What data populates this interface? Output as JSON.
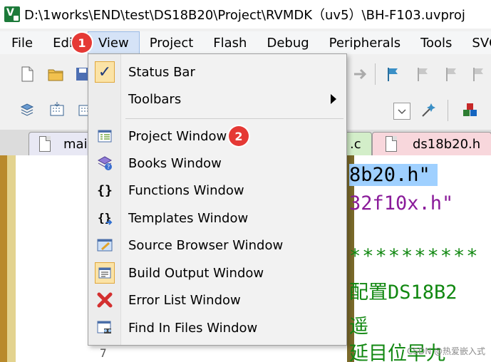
{
  "window": {
    "title": "D:\\1works\\END\\test\\DS18B20\\Project\\RVMDK（uv5）\\BH-F103.uvproj"
  },
  "menubar": {
    "items": [
      "File",
      "Edit",
      "View",
      "Project",
      "Flash",
      "Debug",
      "Peripherals",
      "Tools",
      "SVC"
    ],
    "active": "View"
  },
  "tabs": [
    {
      "label": "mai",
      "color": "#e8e8f4"
    },
    {
      "label": ".c",
      "color": "#d3eec9"
    },
    {
      "label": "ds18b20.h",
      "color": "#f8d7dc"
    }
  ],
  "editor": {
    "lines": [
      "8b20.h\"",
      "32f10x.h\"",
      "**********",
      "配置DS18B2",
      "遥",
      "延目位早九"
    ],
    "line_number": "7"
  },
  "view_menu": {
    "items": [
      {
        "label": "Status Bar",
        "icon": "checkmark-icon",
        "checked": true
      },
      {
        "label": "Toolbars",
        "icon": "",
        "submenu": true
      },
      {
        "label": "Project Window",
        "icon": "project-window-icon"
      },
      {
        "label": "Books Window",
        "icon": "books-icon"
      },
      {
        "label": "Functions Window",
        "icon": "functions-icon"
      },
      {
        "label": "Templates Window",
        "icon": "templates-icon"
      },
      {
        "label": "Source Browser Window",
        "icon": "source-browser-icon"
      },
      {
        "label": "Build Output Window",
        "icon": "build-output-icon",
        "checked": true
      },
      {
        "label": "Error List Window",
        "icon": "error-list-icon"
      },
      {
        "label": "Find In Files Window",
        "icon": "find-in-files-icon"
      }
    ]
  },
  "annotations": {
    "step1": "1",
    "step2": "2"
  },
  "watermark": "CSDN @热爱嵌入式",
  "colors": {
    "badge": "#e53935",
    "highlight": "#d5e3f7",
    "checked_bg": "#fbe3a6"
  }
}
